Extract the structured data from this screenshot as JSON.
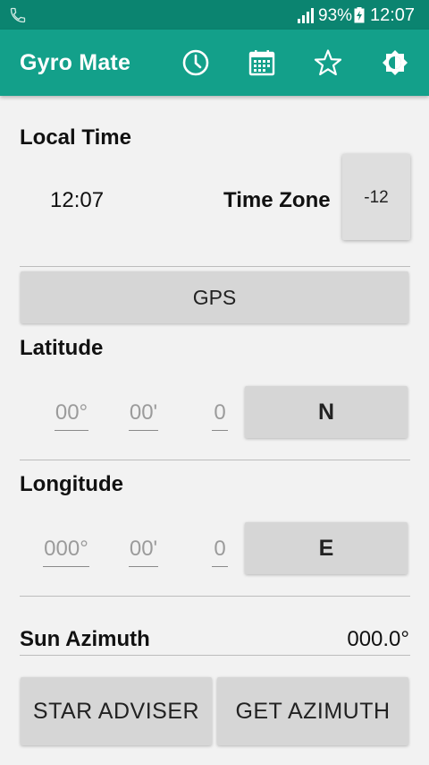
{
  "status_bar": {
    "battery_percent": "93%",
    "time": "12:07",
    "icons": [
      "phone-icon",
      "signal-icon",
      "battery-charging-icon"
    ]
  },
  "toolbar": {
    "title": "Gyro Mate",
    "actions": [
      "clock-icon",
      "calendar-icon",
      "star-icon",
      "brightness-icon"
    ]
  },
  "local_time": {
    "label": "Local Time",
    "value": "12:07",
    "time_zone_label": "Time Zone",
    "time_zone_value": "-12"
  },
  "gps_button": "GPS",
  "latitude": {
    "label": "Latitude",
    "degrees_placeholder": "00°",
    "minutes_placeholder": "00'",
    "seconds_placeholder": "0",
    "hemisphere": "N"
  },
  "longitude": {
    "label": "Longitude",
    "degrees_placeholder": "000°",
    "minutes_placeholder": "00'",
    "seconds_placeholder": "0",
    "hemisphere": "E"
  },
  "sun_azimuth": {
    "label": "Sun Azimuth",
    "value": "000.0°"
  },
  "buttons": {
    "star_adviser": "STAR ADVISER",
    "get_azimuth": "GET AZIMUTH"
  },
  "colors": {
    "status_bar": "#0b8470",
    "toolbar": "#13a08a",
    "background": "#f2f2f2",
    "button": "#d6d6d6"
  }
}
